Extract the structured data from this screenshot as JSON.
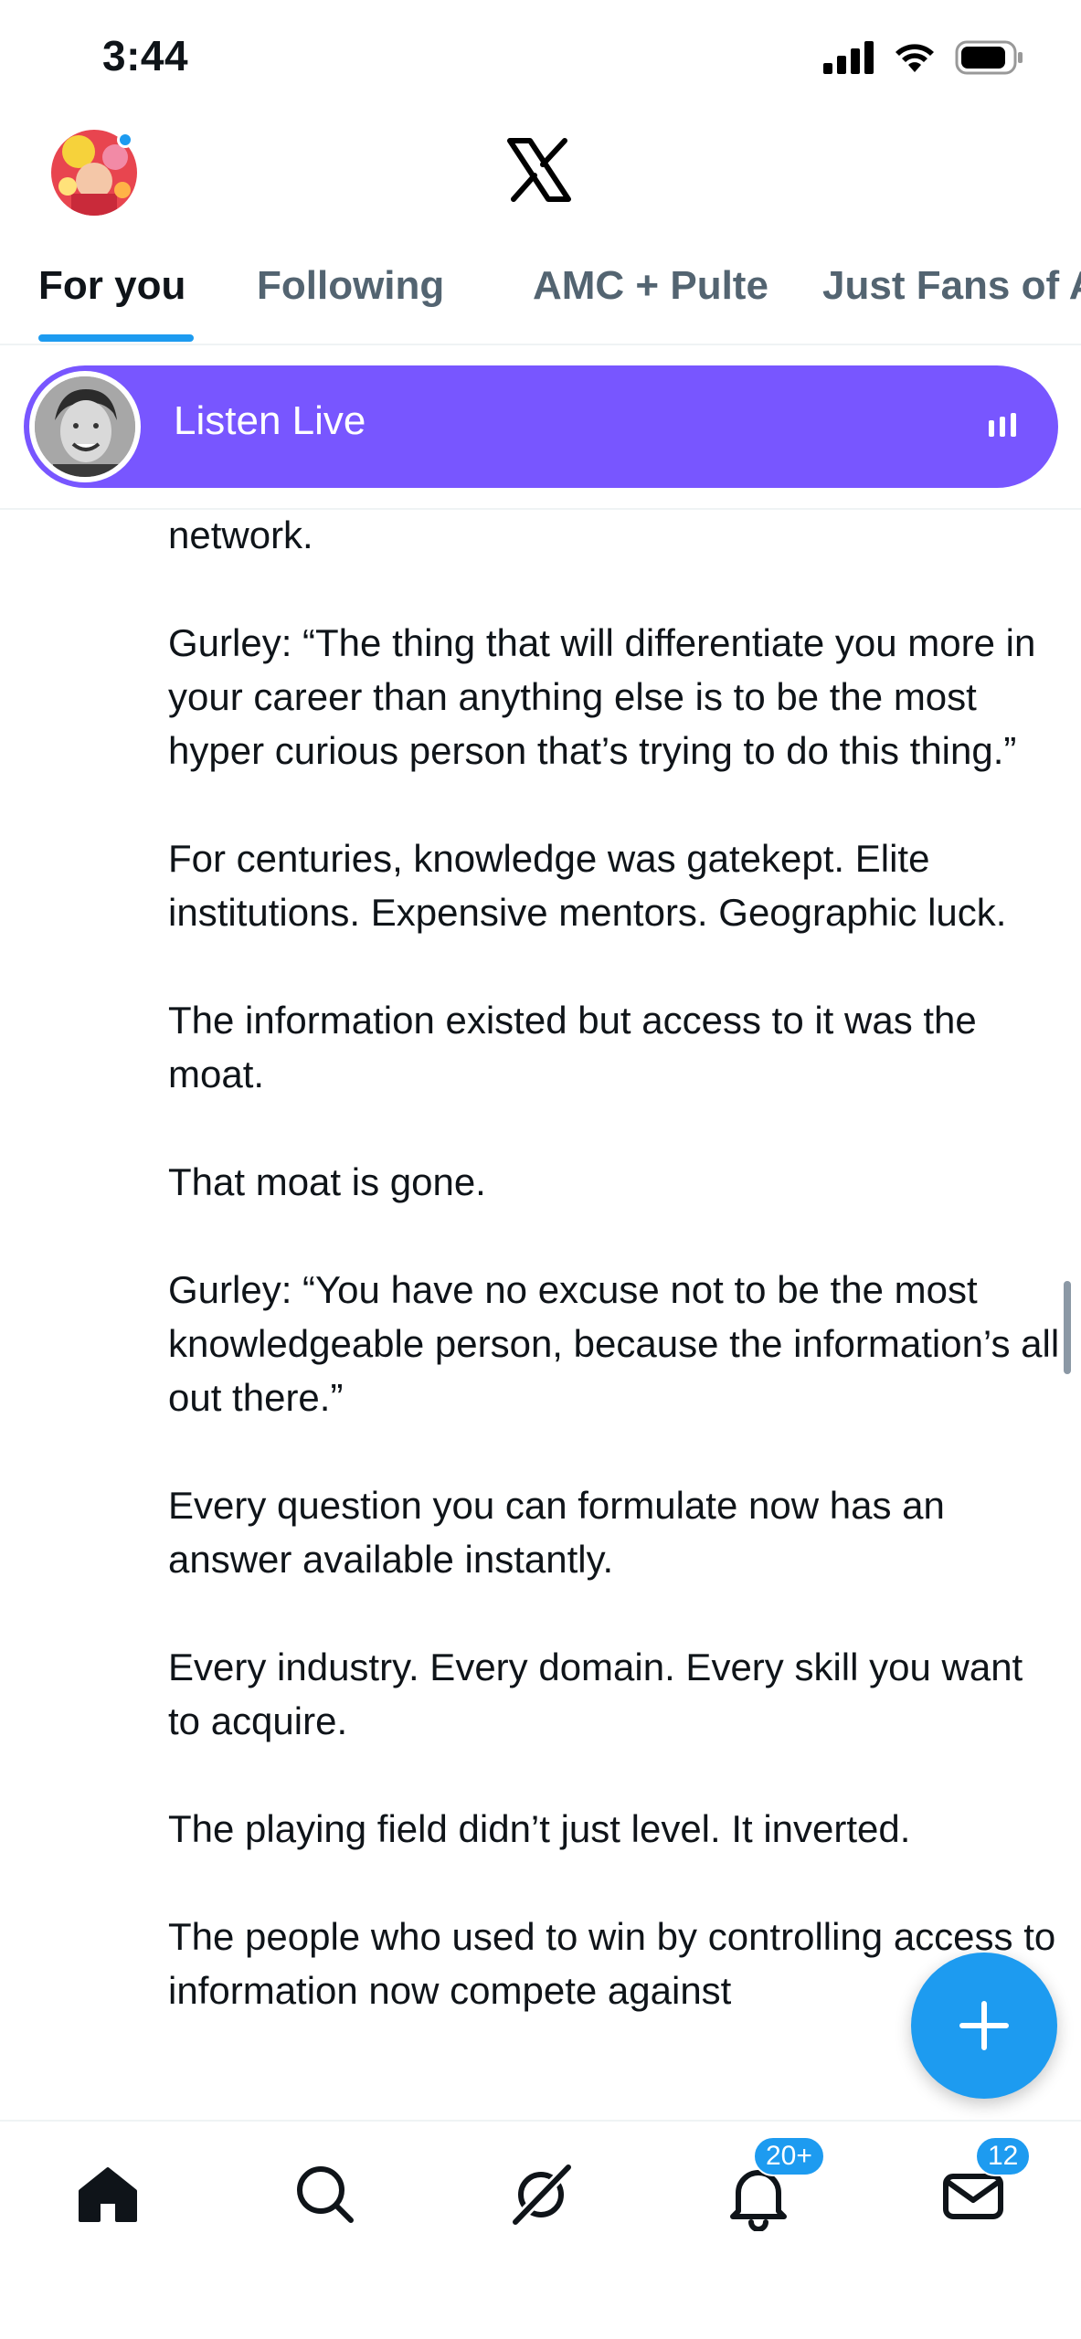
{
  "status_bar": {
    "time": "3:44",
    "battery_icon": "battery-icon",
    "wifi_icon": "wifi-icon",
    "signal_icon": "signal-icon"
  },
  "header": {
    "logo": "X"
  },
  "tabs": [
    {
      "label": "For you",
      "active": true
    },
    {
      "label": "Following",
      "active": false
    },
    {
      "label": "AMC + Pulte",
      "active": false
    },
    {
      "label": "Just Fans of A",
      "active": false
    }
  ],
  "listen_live": {
    "label": "Listen Live",
    "accent": "#7856ff"
  },
  "post": {
    "paragraphs": [
      "network.",
      "Gurley: “The thing that will differentiate you more in your career than anything else is to be the most hyper curious person that’s trying to do this thing.”",
      "For centuries, knowledge was gatekept. Elite institutions. Expensive mentors. Geographic luck.",
      "The information existed but access to it was the moat.",
      "That moat is gone.",
      "Gurley: “You have no excuse not to be the most knowledgeable person, because the information’s all out there.”",
      "Every question you can formulate now has an answer available instantly.",
      "Every industry. Every domain. Every skill you want to acquire.",
      "The playing field didn’t just level. It inverted.",
      "The people who used to win by controlling access to information now compete against"
    ]
  },
  "compose_button": {
    "icon": "plus-icon"
  },
  "bottom_nav": {
    "home_icon": "home-icon",
    "search_icon": "search-icon",
    "grok_icon": "grok-icon",
    "notifications_icon": "bell-icon",
    "notifications_badge": "20+",
    "messages_icon": "mail-icon",
    "messages_badge": "12"
  },
  "colors": {
    "brand": "#1d9bf0",
    "text": "#0f1419",
    "secondary": "#536471"
  }
}
